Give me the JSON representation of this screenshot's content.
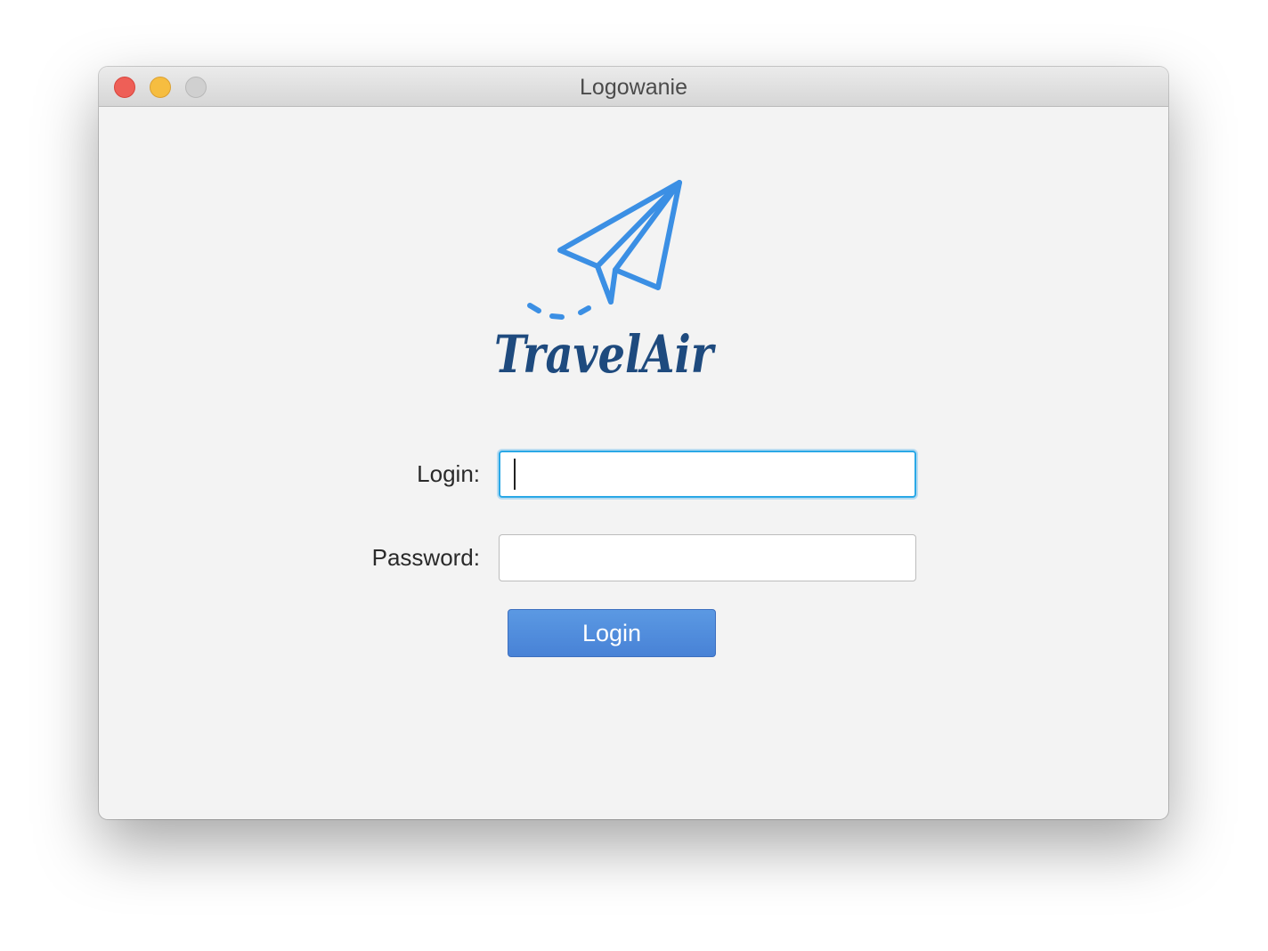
{
  "window": {
    "title": "Logowanie"
  },
  "logo": {
    "brand_text": "TravelAir",
    "icon": "paper-plane-icon",
    "colors": {
      "plane": "#3b8fe4",
      "wordmark": "#1e4a7e"
    }
  },
  "form": {
    "login_label": "Login:",
    "login_value": "",
    "password_label": "Password:",
    "password_value": "",
    "submit_label": "Login"
  },
  "colors": {
    "focus_ring": "#2aa8e6",
    "button": "#4f8ddc"
  }
}
